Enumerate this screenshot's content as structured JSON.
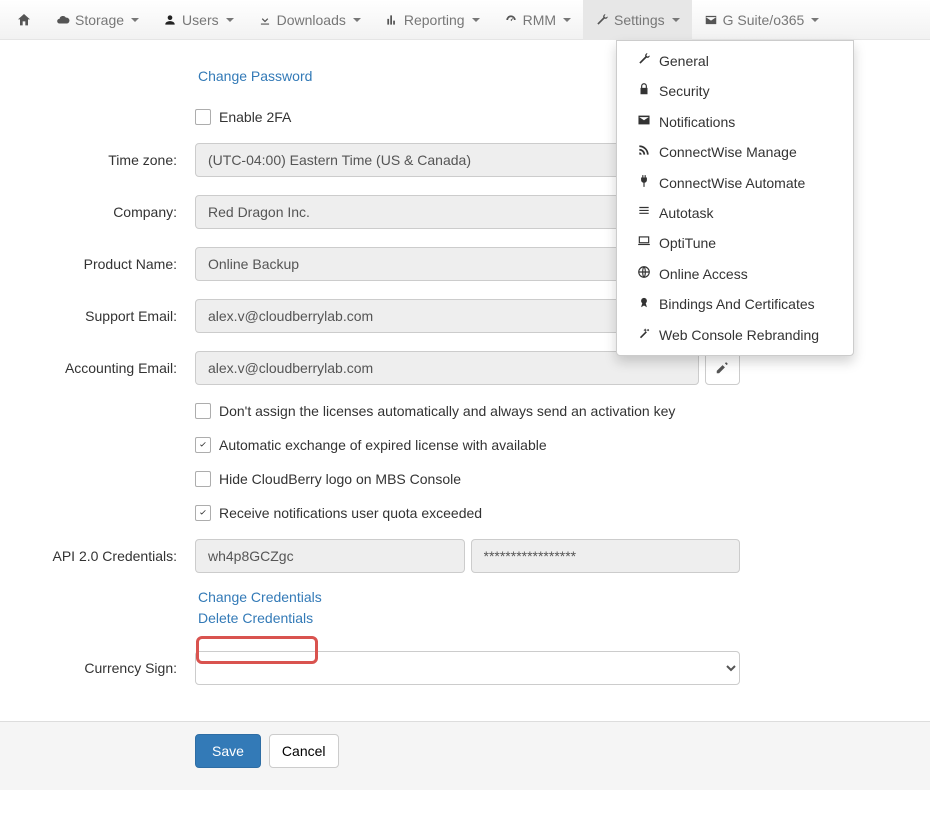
{
  "nav": {
    "storage": "Storage",
    "users": "Users",
    "downloads": "Downloads",
    "reporting": "Reporting",
    "rmm": "RMM",
    "settings": "Settings",
    "gsuite": "G Suite/o365"
  },
  "settings_menu": {
    "general": "General",
    "security": "Security",
    "notifications": "Notifications",
    "cw_manage": "ConnectWise Manage",
    "cw_automate": "ConnectWise Automate",
    "autotask": "Autotask",
    "optitune": "OptiTune",
    "online_access": "Online Access",
    "bindings": "Bindings And Certificates",
    "rebranding": "Web Console Rebranding"
  },
  "form": {
    "change_password": "Change Password",
    "enable_2fa": "Enable 2FA",
    "labels": {
      "timezone": "Time zone:",
      "company": "Company:",
      "product_name": "Product Name:",
      "support_email": "Support Email:",
      "accounting_email": "Accounting Email:",
      "api_credentials": "API 2.0 Credentials:",
      "currency_sign": "Currency Sign:"
    },
    "values": {
      "timezone": "(UTC-04:00) Eastern Time (US & Canada)",
      "company": "Red Dragon Inc.",
      "product_name": "Online Backup",
      "support_email": "alex.v@cloudberrylab.com",
      "accounting_email": "alex.v@cloudberrylab.com",
      "api_user": "wh4p8GCZgc",
      "api_secret": "*****************",
      "currency_sign": ""
    },
    "checks": {
      "dont_assign": "Don't assign the licenses automatically and always send an activation key",
      "auto_exchange": "Automatic exchange of expired license with available",
      "hide_logo": "Hide CloudBerry logo on MBS Console",
      "quota_notify": "Receive notifications user quota exceeded"
    },
    "links": {
      "change_credentials": "Change Credentials",
      "delete_credentials": "Delete Credentials"
    },
    "buttons": {
      "save": "Save",
      "cancel": "Cancel"
    }
  }
}
